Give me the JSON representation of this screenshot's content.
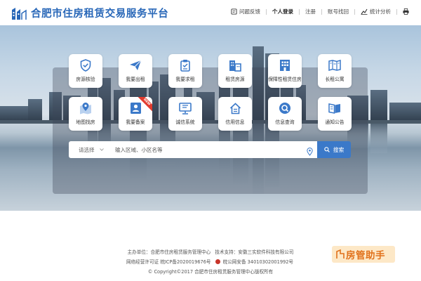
{
  "header": {
    "site_title": "合肥市住房租赁交易服务平台",
    "nav": {
      "feedback": "问题反馈",
      "personal_login": "个人登录",
      "register": "注册",
      "retrieve_account": "账号找回",
      "statistics": "统计分析"
    },
    "accent_color": "#2867b8"
  },
  "services": [
    {
      "label": "房源核验",
      "icon": "shield-check-icon"
    },
    {
      "label": "我要出租",
      "icon": "paper-plane-icon"
    },
    {
      "label": "我要求租",
      "icon": "clipboard-icon"
    },
    {
      "label": "租赁房源",
      "icon": "buildings-icon"
    },
    {
      "label": "保障性租赁住房",
      "icon": "apartment-icon"
    },
    {
      "label": "长租公寓",
      "icon": "map-book-icon"
    },
    {
      "label": "地图找房",
      "icon": "map-pin-icon"
    },
    {
      "label": "我要备案",
      "icon": "id-card-icon",
      "badge": "NEW"
    },
    {
      "label": "诚信系统",
      "icon": "monitor-icon"
    },
    {
      "label": "信用信息",
      "icon": "house-doc-icon"
    },
    {
      "label": "信息查询",
      "icon": "house-search-icon"
    },
    {
      "label": "通知公告",
      "icon": "open-book-icon"
    }
  ],
  "search": {
    "select_label": "请选择",
    "placeholder": "输入区域、小区名等",
    "button_label": "搜索"
  },
  "footer": {
    "sponsor": "主办单位：合肥市住房租赁服务管理中心",
    "tech_support": "技术支持：安徽三实软件科技有限公司",
    "icp": "网络经营许可证 皖ICP备2020019676号",
    "police": "皖公网安备 34010302001992号",
    "copyright": "© Copyright©2017 合肥市住房租赁服务管理中心版权所有",
    "helper": "房管助手",
    "helper_color": "#e1711b"
  }
}
